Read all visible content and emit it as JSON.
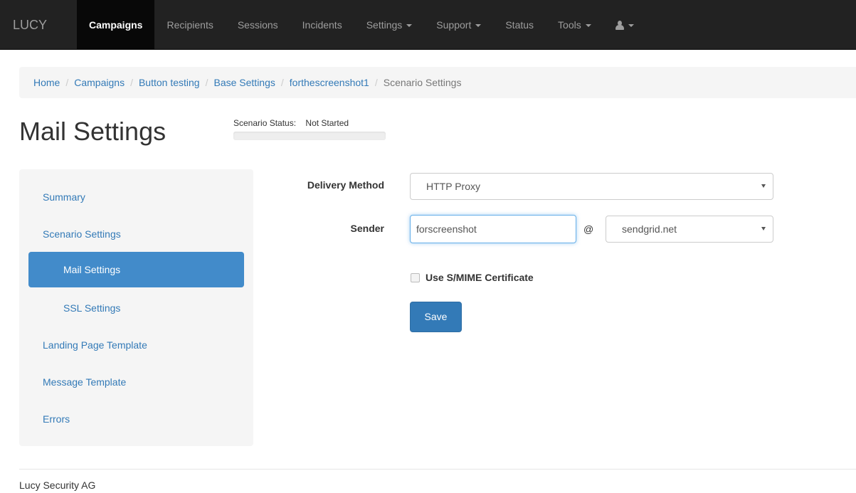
{
  "navbar": {
    "brand": "LUCY",
    "items": [
      {
        "label": "Campaigns",
        "active": true
      },
      {
        "label": "Recipients"
      },
      {
        "label": "Sessions"
      },
      {
        "label": "Incidents"
      },
      {
        "label": "Settings",
        "dropdown": true
      },
      {
        "label": "Support",
        "dropdown": true
      },
      {
        "label": "Status"
      },
      {
        "label": "Tools",
        "dropdown": true
      }
    ],
    "user_icon": "user-icon"
  },
  "breadcrumb": {
    "items": [
      "Home",
      "Campaigns",
      "Button testing",
      "Base Settings",
      "forthescreenshot1"
    ],
    "active": "Scenario Settings",
    "separator": "/"
  },
  "page": {
    "title": "Mail Settings",
    "status_label": "Scenario Status:",
    "status_value": "Not Started"
  },
  "sidebar": {
    "items": [
      {
        "label": "Summary"
      },
      {
        "label": "Scenario Settings"
      },
      {
        "label": "Mail Settings",
        "active": true
      },
      {
        "label": "SSL Settings"
      },
      {
        "label": "Landing Page Template"
      },
      {
        "label": "Message Template"
      },
      {
        "label": "Errors"
      }
    ]
  },
  "form": {
    "delivery_method_label": "Delivery Method",
    "delivery_method_value": "HTTP Proxy",
    "sender_label": "Sender",
    "sender_value": "forscreenshot",
    "at_sign": "@",
    "domain_value": "sendgrid.net",
    "smime_label": "Use S/MIME Certificate",
    "smime_checked": false,
    "save_label": "Save"
  },
  "footer": {
    "company": "Lucy Security AG"
  },
  "colors": {
    "navbar_bg": "#222222",
    "link": "#337ab7",
    "active_sidebar": "#428bca",
    "primary_button": "#337ab7"
  }
}
